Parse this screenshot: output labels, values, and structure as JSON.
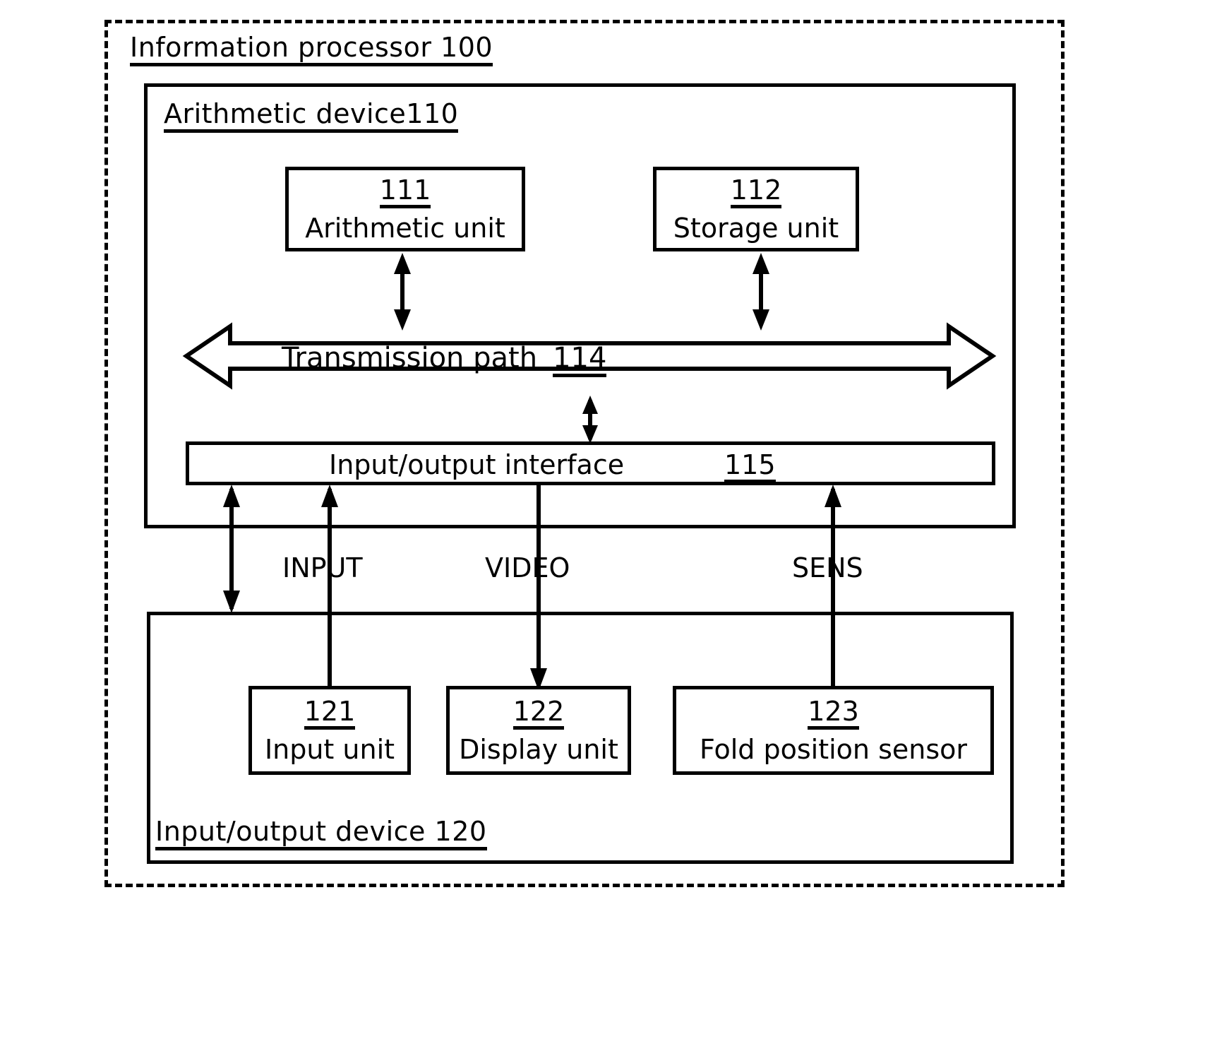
{
  "diagram": {
    "outer": {
      "label": "Information processor 100",
      "style": "dashed"
    },
    "arithmetic_device": {
      "label": "Arithmetic device110"
    },
    "units": [
      {
        "number": "111",
        "label": "Arithmetic unit"
      },
      {
        "number": "112",
        "label": "Storage unit"
      }
    ],
    "transmission_path": {
      "label": "Transmission path",
      "number": "114",
      "arrow": "double-headed-horizontal"
    },
    "io_interface": {
      "label": "Input/output interface",
      "number": "115"
    },
    "signals": [
      {
        "name": "INPUT",
        "direction": "up"
      },
      {
        "name": "VIDEO",
        "direction": "down"
      },
      {
        "name": "SENS",
        "direction": "up"
      }
    ],
    "io_device": {
      "label": "Input/output device 120"
    },
    "io_units": [
      {
        "number": "121",
        "label": "Input unit"
      },
      {
        "number": "122",
        "label": "Display unit"
      },
      {
        "number": "123",
        "label": "Fold position sensor"
      }
    ],
    "colors": {
      "line": "#000000",
      "background": "#ffffff"
    }
  }
}
